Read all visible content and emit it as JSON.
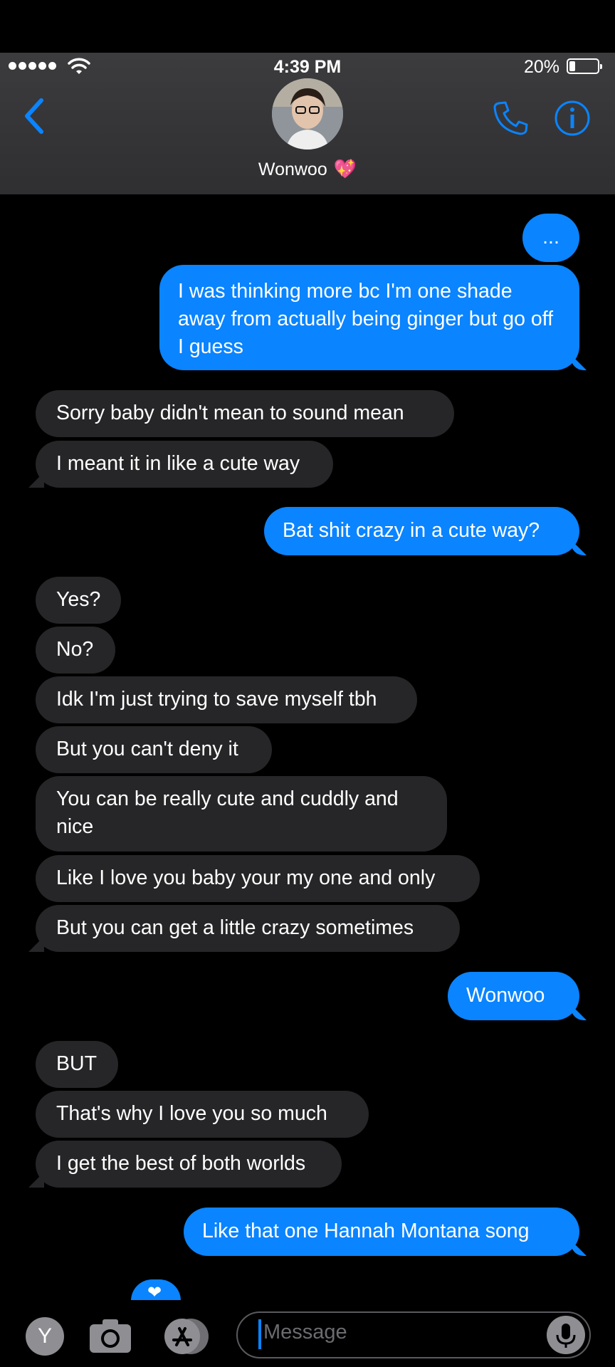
{
  "status_bar": {
    "time": "4:39 PM",
    "battery_percent_text": "20%",
    "battery_level": 0.2
  },
  "header": {
    "contact_name": "Wonwoo",
    "contact_emoji": "💖",
    "back_icon": "chevron-left-icon",
    "call_icon": "phone-icon",
    "info_icon": "info-icon"
  },
  "messages": [
    {
      "direction": "outgoing",
      "text": "..."
    },
    {
      "direction": "outgoing",
      "text": "I was thinking more bc I'm one shade away from actually being ginger but go off I guess"
    },
    {
      "direction": "incoming",
      "text": "Sorry baby didn't mean to sound mean"
    },
    {
      "direction": "incoming",
      "text": "I meant it in like a cute way"
    },
    {
      "direction": "outgoing",
      "text": "Bat shit crazy in a cute way?"
    },
    {
      "direction": "incoming",
      "text": "Yes?"
    },
    {
      "direction": "incoming",
      "text": "No?"
    },
    {
      "direction": "incoming",
      "text": "Idk I'm just trying to save myself tbh"
    },
    {
      "direction": "incoming",
      "text": "But you can't deny it"
    },
    {
      "direction": "incoming",
      "text": "You can be really cute and cuddly and nice"
    },
    {
      "direction": "incoming",
      "text": "Like I love you baby your my one and only"
    },
    {
      "direction": "incoming",
      "text": "But you can get a little crazy sometimes"
    },
    {
      "direction": "outgoing",
      "text": "Wonwoo"
    },
    {
      "direction": "incoming",
      "text": "BUT"
    },
    {
      "direction": "incoming",
      "text": "That's why I love you so much"
    },
    {
      "direction": "incoming",
      "text": "I get the best of both worlds"
    },
    {
      "direction": "outgoing",
      "text": "Like that one Hannah Montana song"
    }
  ],
  "partial_reaction": "❤",
  "compose_bar": {
    "app_y_label": "Y",
    "camera_icon": "camera-icon",
    "appstore_icon": "app-store-icon",
    "message_placeholder": "Message",
    "mic_icon": "microphone-icon"
  },
  "colors": {
    "outgoing_bubble": "#0a84ff",
    "incoming_bubble": "#262628",
    "accent": "#0a84ff",
    "header_background": "#363638"
  }
}
